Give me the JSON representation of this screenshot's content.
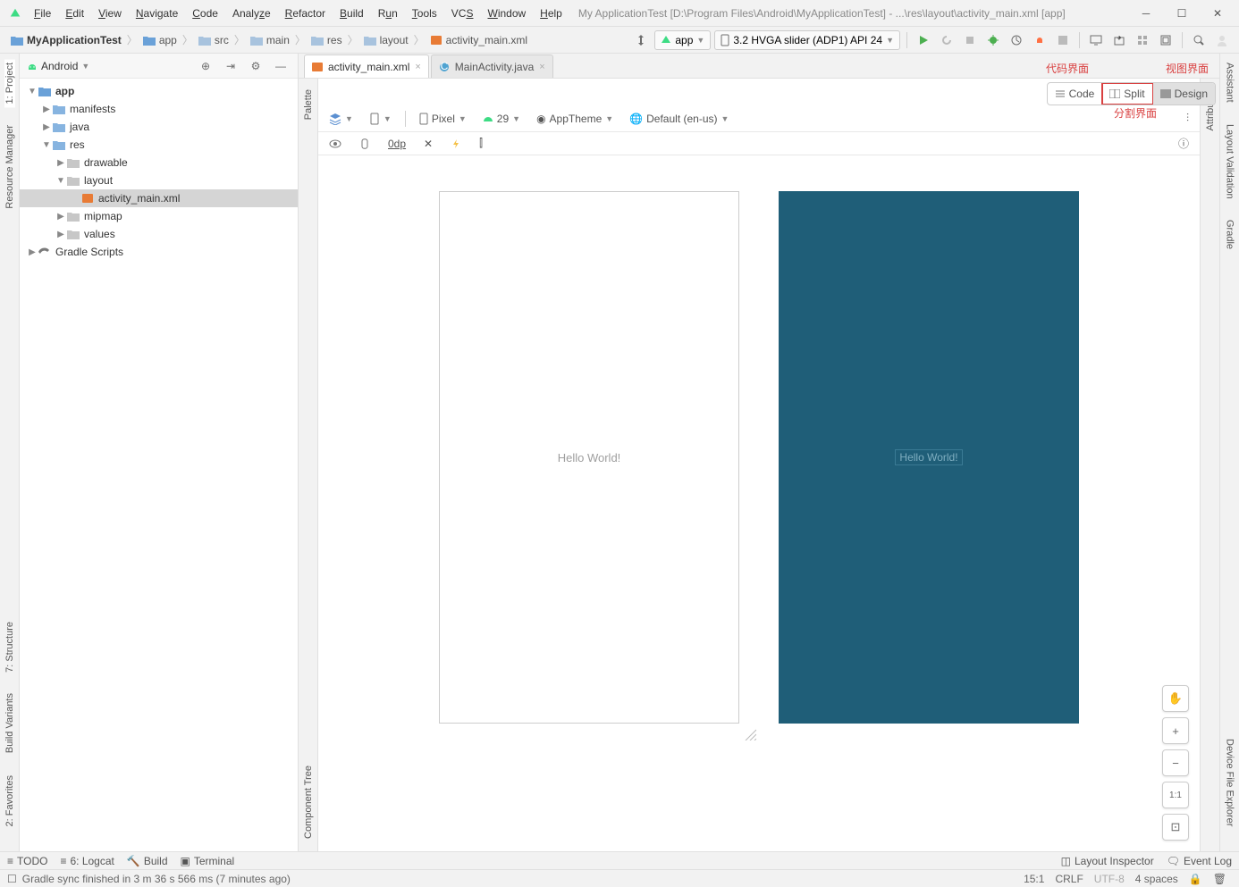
{
  "menu": [
    "File",
    "Edit",
    "View",
    "Navigate",
    "Code",
    "Analyze",
    "Refactor",
    "Build",
    "Run",
    "Tools",
    "VCS",
    "Window",
    "Help"
  ],
  "title_path": "My ApplicationTest [D:\\Program Files\\Android\\MyApplicationTest] - ...\\res\\layout\\activity_main.xml [app]",
  "breadcrumbs": [
    "MyApplicationTest",
    "app",
    "src",
    "main",
    "res",
    "layout",
    "activity_main.xml"
  ],
  "run": {
    "module": "app",
    "device": "3.2  HVGA slider (ADP1) API 24"
  },
  "project": {
    "view_mode": "Android",
    "tree": {
      "app": "app",
      "manifests": "manifests",
      "java": "java",
      "res": "res",
      "drawable": "drawable",
      "layout": "layout",
      "activity_main": "activity_main.xml",
      "mipmap": "mipmap",
      "values": "values",
      "gradle": "Gradle Scripts"
    }
  },
  "left_gutter": [
    "1: Project",
    "Resource Manager",
    "7: Structure",
    "Build Variants",
    "2: Favorites"
  ],
  "right_gutter": [
    "Assistant",
    "Layout Validation",
    "Gradle",
    "Device File Explorer"
  ],
  "attr_gutter": "Attributes",
  "tabs": [
    {
      "label": "activity_main.xml",
      "active": true
    },
    {
      "label": "MainActivity.java",
      "active": false
    }
  ],
  "modes": {
    "code": "Code",
    "split": "Split",
    "design": "Design"
  },
  "annotations": {
    "code": "代码界面",
    "split": "分割界面",
    "design": "视图界面"
  },
  "design_toolbar": {
    "device": "Pixel",
    "api": "29",
    "theme": "AppTheme",
    "locale": "Default (en-us)",
    "margin": "0dp"
  },
  "palette": "Palette",
  "component_tree": "Component Tree",
  "preview_text": "Hello World!",
  "zoom": {
    "ratio": "1:1"
  },
  "bottom": {
    "todo": "TODO",
    "logcat": "6: Logcat",
    "build": "Build",
    "terminal": "Terminal",
    "inspector": "Layout Inspector",
    "eventlog": "Event Log"
  },
  "status": {
    "msg": "Gradle sync finished in 3 m 36 s 566 ms (7 minutes ago)",
    "pos": "15:1",
    "eol": "CRLF",
    "enc": "UTF-8",
    "indent": "4 spaces"
  }
}
